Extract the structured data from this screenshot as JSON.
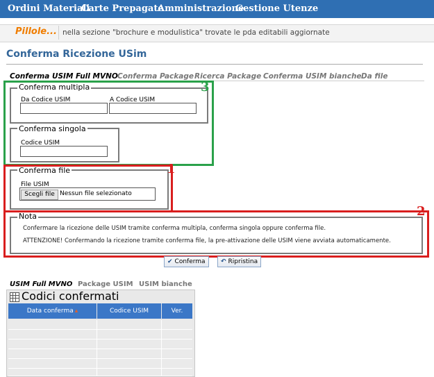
{
  "nav": {
    "items": [
      "Ordini Materiali",
      "Carte Prepagate",
      "Amministrazione",
      "Gestione Utenze"
    ]
  },
  "pillole": {
    "label": "Pillole...",
    "text": "nella sezione \"brochure e modulistica\" trovate le pda editabili aggiornate"
  },
  "page": {
    "title": "Conferma Ricezione USim"
  },
  "tabs": [
    "Conferma USIM Full MVNO",
    "Conferma Package",
    "Ricerca Package",
    "Conferma USIM bianche",
    "Da file"
  ],
  "multipla": {
    "legend": "Conferma multipla",
    "from_label": "Da Codice USIM",
    "to_label": "A Codice USIM",
    "from_value": "",
    "to_value": ""
  },
  "singola": {
    "legend": "Conferma singola",
    "code_label": "Codice USIM",
    "code_value": ""
  },
  "file": {
    "legend": "Conferma file",
    "label": "File USIM",
    "button": "Scegli file",
    "status": "Nessun file selezionato"
  },
  "nota": {
    "legend": "Nota",
    "line1": "Confermare la ricezione delle USIM tramite conferma multipla, conferma singola oppure conferma file.",
    "line2": "ATTENZIONE! Confermando la ricezione tramite conferma file, la pre-attivazione delle USIM viene avviata automaticamente."
  },
  "annotations": {
    "n1": "1",
    "n2": "2",
    "n3": "3",
    "red": "#d91e1e",
    "green": "#2aa14a"
  },
  "buttons": {
    "conferma": "Conferma",
    "ripristina": "Ripristina"
  },
  "bottom_tabs": [
    "USIM Full MVNO",
    "Package USIM",
    "USIM bianche"
  ],
  "codici": {
    "title": "Codici confermati",
    "columns": [
      "Data conferma",
      "Codice USIM",
      "Ver."
    ]
  }
}
